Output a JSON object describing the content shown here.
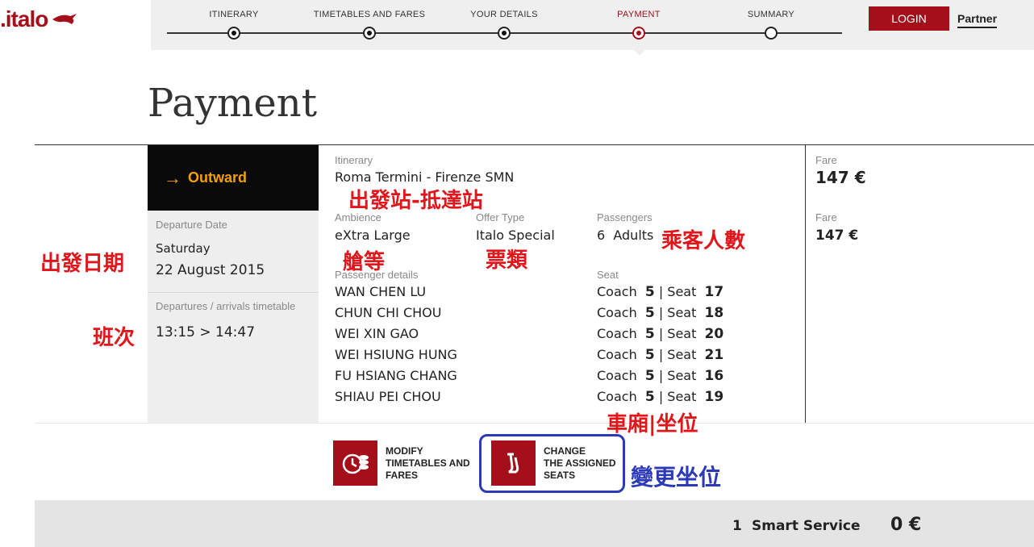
{
  "brand": {
    "name": ".italo",
    "color": "#a50f1a"
  },
  "steps": [
    {
      "label": "ITINERARY",
      "state": "done"
    },
    {
      "label": "TIMETABLES AND FARES",
      "state": "done"
    },
    {
      "label": "YOUR DETAILS",
      "state": "done"
    },
    {
      "label": "PAYMENT",
      "state": "active"
    },
    {
      "label": "SUMMARY",
      "state": "pending"
    }
  ],
  "header": {
    "login_label": "LOGIN",
    "partner_label": "Partner"
  },
  "page": {
    "title": "Payment"
  },
  "journey": {
    "direction_label": "Outward",
    "departure_date_label": "Departure Date",
    "departure_day": "Saturday",
    "departure_date": "22 August 2015",
    "timetable_label": "Departures / arrivals timetable",
    "timetable": "13:15 > 14:47"
  },
  "itinerary": {
    "label": "Itinerary",
    "value": "Roma Termini - Firenze SMN",
    "ambience_label": "Ambience",
    "ambience": "eXtra Large",
    "offer_label": "Offer Type",
    "offer": "Italo Special",
    "passengers_label": "Passengers",
    "passengers_count": "6",
    "passengers_unit": "Adults",
    "passenger_details_label": "Passenger details",
    "seat_label": "Seat"
  },
  "passengers": [
    {
      "name": "WAN CHEN LU",
      "coach": "5",
      "seat": "17"
    },
    {
      "name": "CHUN CHI CHOU",
      "coach": "5",
      "seat": "18"
    },
    {
      "name": "WEI XIN GAO",
      "coach": "5",
      "seat": "20"
    },
    {
      "name": "WEI HSIUNG HUNG",
      "coach": "5",
      "seat": "21"
    },
    {
      "name": "FU HSIANG CHANG",
      "coach": "5",
      "seat": "16"
    },
    {
      "name": "SHIAU PEI CHOU",
      "coach": "5",
      "seat": "19"
    }
  ],
  "seat_words": {
    "coach": "Coach",
    "sep": "|",
    "seat": "Seat"
  },
  "fares": [
    {
      "label": "Fare",
      "value": "147 €"
    },
    {
      "label": "Fare",
      "value": "147 €"
    }
  ],
  "actions": {
    "modify_line1": "MODIFY",
    "modify_line2": "TIMETABLES AND",
    "modify_line3": "FARES",
    "change_line1": "CHANGE",
    "change_line2": "THE ASSIGNED",
    "change_line3": "SEATS"
  },
  "service": {
    "count": "1",
    "name": "Smart Service",
    "price": "0 €"
  },
  "annotations": {
    "stations": "出發站-抵達站",
    "departure_date": "出發日期",
    "train": "班次",
    "cabin": "艙等",
    "ticket_type": "票類",
    "passenger_count": "乘客人數",
    "coach_seat": "車廂|坐位",
    "change_seat": "變更坐位"
  }
}
